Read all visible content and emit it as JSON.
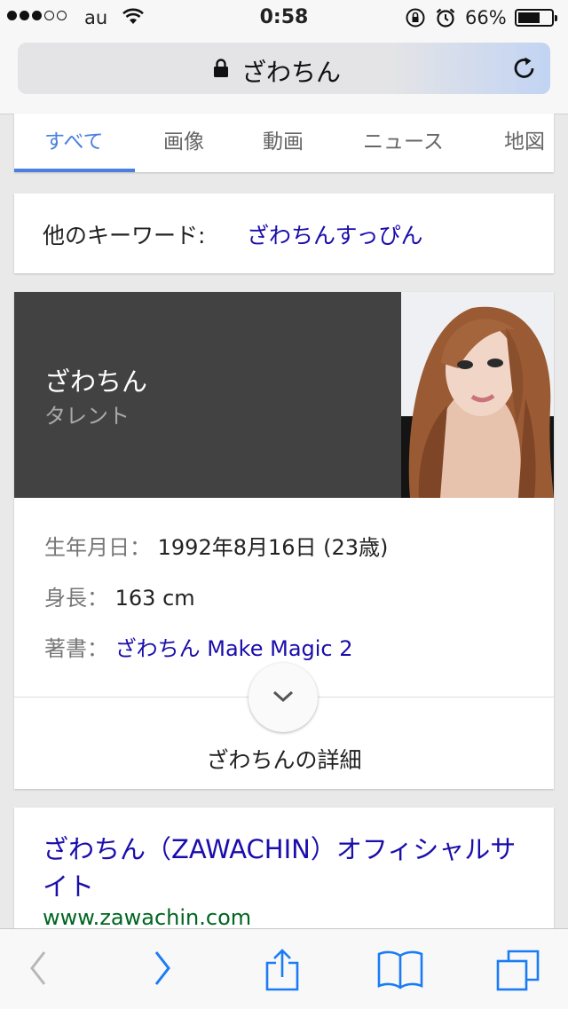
{
  "status_bar": {
    "carrier": "au",
    "time": "0:58",
    "battery_percent": "66%",
    "battery_level": 0.66,
    "signal_strength": 3,
    "signal_max": 5
  },
  "url_bar": {
    "title": "ざわちん"
  },
  "search_tabs": [
    "すべて",
    "画像",
    "動画",
    "ニュース",
    "地図"
  ],
  "active_tab": "すべて",
  "related_keywords": {
    "label": "他のキーワード:",
    "link": "ざわちんすっぴん"
  },
  "knowledge_panel": {
    "name": "ざわちん",
    "type": "タレント",
    "facts": [
      {
        "label": "生年月日：",
        "value": "1992年8月16日 (23歳)"
      },
      {
        "label": "身長：",
        "value": "163 cm"
      },
      {
        "label": "著書：",
        "value": "ざわちん Make Magic 2"
      }
    ],
    "more_label": "ざわちんの詳細"
  },
  "result": {
    "title": "ざわちん（ZAWACHIN）オフィシャルサイト",
    "url": "www.zawachin.com"
  },
  "colors": {
    "accent": "#4a7fdf",
    "link": "#1a0dab",
    "url_green": "#006621",
    "panel_dark": "#424242",
    "ios_blue": "#1a7cf5"
  },
  "icons": [
    "signal-dots",
    "wifi-icon",
    "rotation-lock-icon",
    "alarm-icon",
    "battery-icon",
    "lock-icon",
    "reload-icon",
    "chevron-down-icon",
    "back-icon",
    "forward-icon",
    "share-icon",
    "bookmarks-icon",
    "tabs-icon"
  ]
}
